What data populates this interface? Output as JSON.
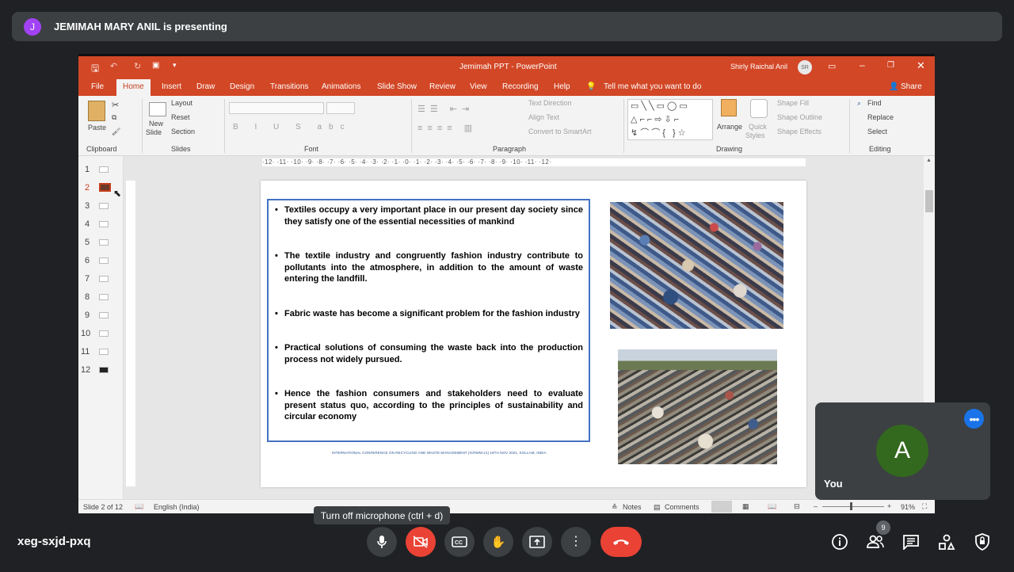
{
  "meet": {
    "presenter_initial": "J",
    "presenter_text": "JEMIMAH MARY ANIL is presenting",
    "meeting_code": "xeg-sxjd-pxq",
    "tooltip": "Turn off microphone (ctrl + d)",
    "you_initial": "A",
    "you_label": "You",
    "more_label": "•••",
    "people_count": "9"
  },
  "ppt": {
    "window_title": "Jemimah PPT  -  PowerPoint",
    "user_name": "Shirly Raichal Anil",
    "user_initials": "SR",
    "tabs": [
      "File",
      "Home",
      "Insert",
      "Draw",
      "Design",
      "Transitions",
      "Animations",
      "Slide Show",
      "Review",
      "View",
      "Recording",
      "Help"
    ],
    "tell_me": "Tell me what you want to do",
    "share": "Share",
    "ribbon": {
      "clipboard": {
        "paste": "Paste",
        "group": "Clipboard"
      },
      "slides": {
        "new_slide_1": "New",
        "new_slide_2": "Slide",
        "layout": "Layout",
        "reset": "Reset",
        "section": "Section",
        "group": "Slides"
      },
      "font": {
        "group": "Font"
      },
      "paragraph": {
        "text_direction": "Text Direction",
        "align_text": "Align Text",
        "convert_smartart": "Convert to SmartArt",
        "group": "Paragraph"
      },
      "drawing": {
        "arrange": "Arrange",
        "quick_styles_1": "Quick",
        "quick_styles_2": "Styles",
        "shape_fill": "Shape Fill",
        "shape_outline": "Shape Outline",
        "shape_effects": "Shape Effects",
        "group": "Drawing"
      },
      "editing": {
        "find": "Find",
        "replace": "Replace",
        "select": "Select",
        "group": "Editing"
      }
    },
    "ruler_text": "·12· ·11· ·10· ·9· ·8· ·7· ·6· ·5· ·4· ·3· ·2· ·1· ·0· ·1· ·2· ·3· ·4· ·5· ·6· ·7· ·8· ·9· ·10· ·11· ·12·",
    "slide_numbers": [
      "1",
      "2",
      "3",
      "4",
      "5",
      "6",
      "7",
      "8",
      "9",
      "10",
      "11",
      "12"
    ],
    "selected_slide": "2",
    "slide": {
      "bullets": [
        "Textiles occupy a very important place in our present day society since they satisfy one of the essential necessities of mankind",
        "The textile industry and congruently fashion industry contribute to pollutants into the atmosphere, in addition to  the amount of waste entering the landfill.",
        "Fabric waste has become a significant problem for the fashion industry",
        "Practical solutions of consuming the waste back into the production process not widely pursued.",
        " Hence the fashion consumers and stakeholders need to evaluate present status quo, according to the principles of sustainability and circular economy"
      ],
      "footer": "INTERNATIONAL CONFERENCE ON RECYCLING AND WASTE MANAGEMENT (ICRWM-21) 19TH NOV 2021, KOLLAM, INDIA"
    },
    "status": {
      "slide_of": "Slide 2 of 12",
      "language": "English (India)",
      "notes": "Notes",
      "comments": "Comments",
      "zoom": "91%"
    },
    "colors": {
      "accent": "#d24726",
      "meet_bg": "#202124",
      "end_call": "#ea4335"
    }
  }
}
